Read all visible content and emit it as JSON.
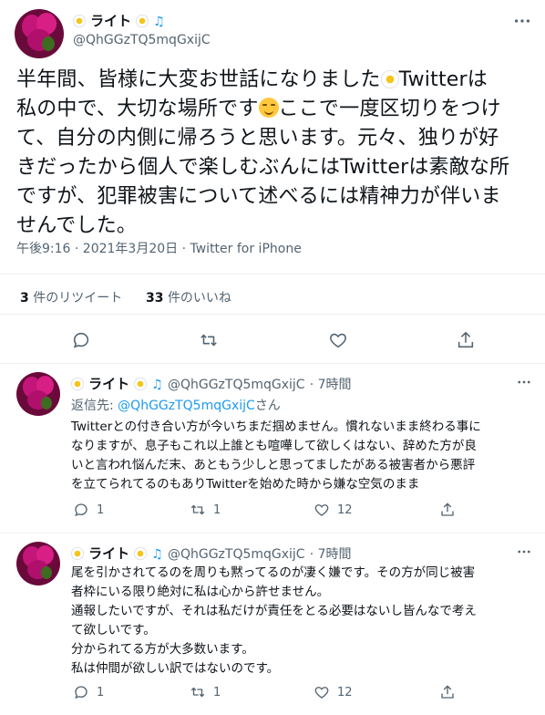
{
  "main_tweet": {
    "display_name": "ライト",
    "handle": "@QhGGzTQ5mqGxijC",
    "text_lines": [
      "半年間、皆様に大変お世話になりました",
      "Twitterは",
      "私の中で、大切な場所です",
      "ここで一度区切りをつけ",
      "て、自分の内側に帰ろうと思います。元々、独りが好",
      "きだったから個人で楽しむぶんにはTwitterは素敵な所",
      "ですが、犯罪被害について述べるには精神力が伴いま",
      "せんでした。"
    ],
    "timestamp": "午後9:16 · 2021年3月20日 · Twitter for iPhone",
    "stats": {
      "retweets_count": "3",
      "retweets_label": "件のリツイート",
      "likes_count": "33",
      "likes_label": "件のいいね"
    }
  },
  "replies": [
    {
      "display_name": "ライト",
      "handle": "@QhGGzTQ5mqGxijC",
      "time": "· 7時間",
      "reply_to_prefix": "返信先: ",
      "reply_to_handle": "@QhGGzTQ5mqGxijC",
      "reply_to_suffix": "さん",
      "lines": [
        "Twitterとの付き合い方が今いちまだ掴めません。慣れないまま終わる事に",
        "なりますが、息子もこれ以上誰とも喧嘩して欲しくはない、辞めた方が良",
        "いと言われ悩んだ末、あともう少しと思ってましたがある被害者から悪評",
        "を立てられてるのもありTwitterを始めた時から嫌な空気のまま"
      ],
      "reply_count": "1",
      "retweet_count": "1",
      "like_count": "12"
    },
    {
      "display_name": "ライト",
      "handle": "@QhGGzTQ5mqGxijC",
      "time": "· 7時間",
      "lines": [
        "尾を引かされてるのを周りも黙ってるのが凄く嫌です。その方が同じ被害",
        "者枠にいる限り絶対に私は心から許せません。",
        "通報したいですが、それは私だけが責任をとる必要はないし皆んなで考え",
        "て欲しいです。",
        "分かられてる方が大多数います。",
        "私は仲間が欲しい訳ではないのです。"
      ],
      "reply_count": "1",
      "retweet_count": "1",
      "like_count": "12"
    }
  ],
  "icons": {
    "more": "more-icon",
    "reply": "reply-icon",
    "retweet": "retweet-icon",
    "like": "heart-icon",
    "share": "share-icon"
  },
  "colors": {
    "accent": "#1d9bf0",
    "muted": "#536471",
    "divider": "#eff3f4"
  }
}
